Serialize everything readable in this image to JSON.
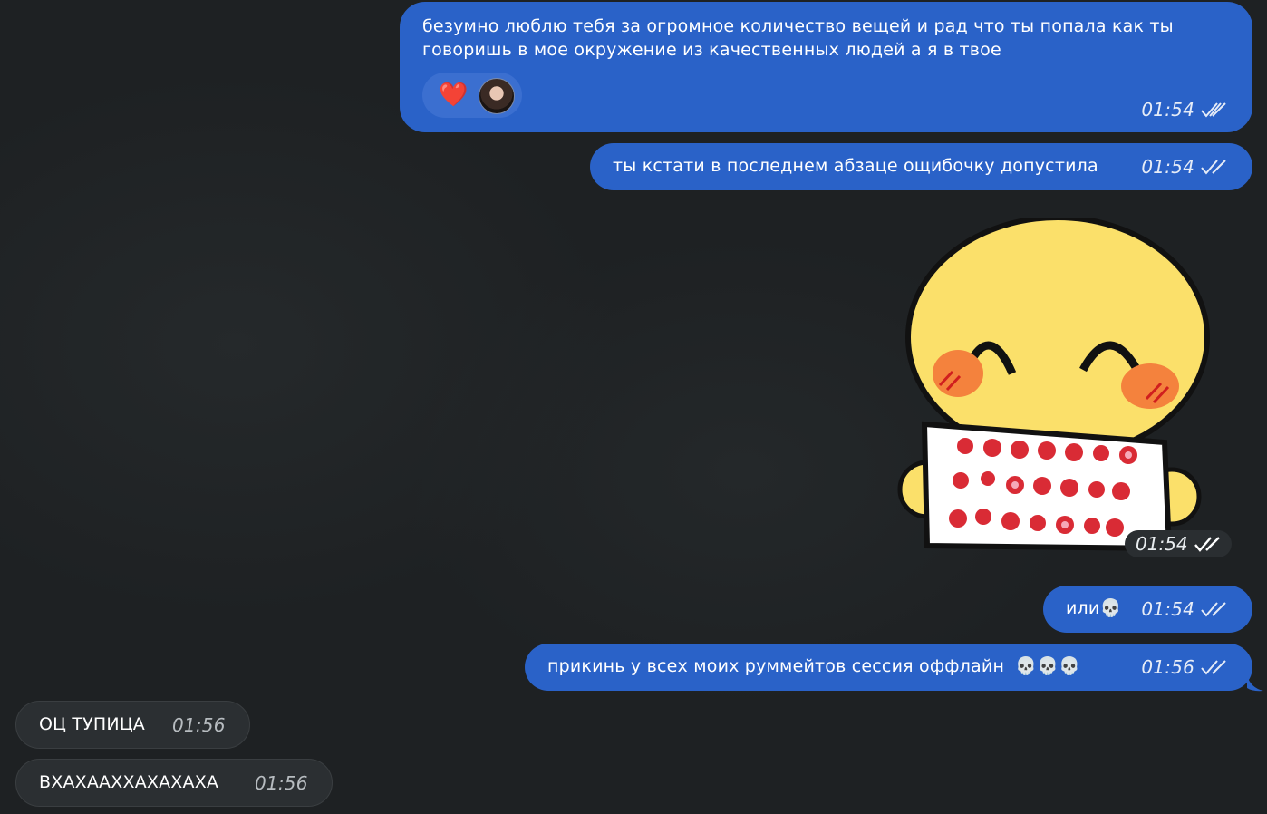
{
  "messages": [
    {
      "id": "m1",
      "direction": "out",
      "text_line1": "безумно люблю тебя за огромное количество вещей и рад что ты попала как ты",
      "text_line2": "говоришь в мое окружение из качественных людей а я в твое",
      "time": "01:54",
      "reaction": "❤️"
    },
    {
      "id": "m2",
      "direction": "out",
      "text": "ты кстати в последнем абзаце ощибочку допустила",
      "time": "01:54"
    },
    {
      "id": "m3",
      "direction": "out",
      "type": "sticker",
      "time": "01:54"
    },
    {
      "id": "m4",
      "direction": "out",
      "text": "или",
      "emoji": "💀",
      "time": "01:54"
    },
    {
      "id": "m5",
      "direction": "out",
      "text": "прикинь у всех моих руммейтов сессия оффлайн",
      "emoji": "💀💀💀",
      "time": "01:56"
    },
    {
      "id": "m6",
      "direction": "in",
      "text": "ОЦ ТУПИЦА",
      "time": "01:56"
    },
    {
      "id": "m7",
      "direction": "in",
      "text": "ВХАХААХХАХАХАХА",
      "time": "01:56"
    }
  ],
  "colors": {
    "outgoing": "#2a62c8",
    "incoming": "#2b2f32",
    "background": "#1e2123"
  }
}
